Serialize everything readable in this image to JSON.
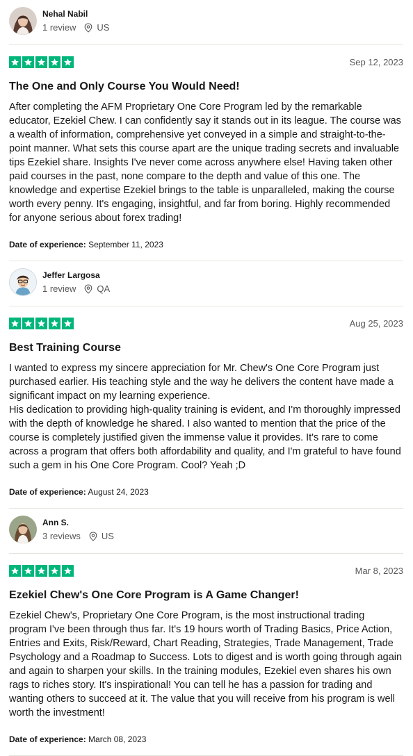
{
  "colors": {
    "star_green": "#00b67a",
    "muted": "#575757",
    "divider": "#e5e5dd"
  },
  "reviews": [
    {
      "reviewer": {
        "name": "Nehal Nabil",
        "review_count": "1 review",
        "country": "US"
      },
      "rating": 5,
      "date": "Sep 12, 2023",
      "title": "The One and Only Course You Would Need!",
      "body": [
        "After completing the AFM Proprietary One Core Program led by the remarkable educator, Ezekiel Chew. I can confidently say it stands out in its league. The course was a wealth of information, comprehensive yet conveyed in a simple and straight-to-the-point manner. What sets this course apart are the unique trading secrets and invaluable tips Ezekiel share. Insights I've never come across anywhere else! Having taken other paid courses in the past, none compare to the depth and value of this one. The knowledge and expertise Ezekiel brings to the table is unparalleled, making the course worth every penny. It's engaging, insightful, and far from boring. Highly recommended for anyone serious about forex trading!"
      ],
      "experience_label": "Date of experience:",
      "experience_date": "September 11, 2023"
    },
    {
      "reviewer": {
        "name": "Jeffer Largosa",
        "review_count": "1 review",
        "country": "QA"
      },
      "rating": 5,
      "date": "Aug 25, 2023",
      "title": "Best Training Course",
      "body": [
        "I wanted to express my sincere appreciation for Mr. Chew's One Core Program just purchased earlier. His teaching style and the way he delivers the content have made a significant impact on my learning experience.",
        "His dedication to providing high-quality training is evident, and I'm thoroughly impressed with the depth of knowledge he shared. I also wanted to mention that the price of the course is completely justified given the immense value it provides. It's rare to come across a program that offers both affordability and quality, and I'm grateful to have found such a gem in his One Core Program. Cool? Yeah ;D"
      ],
      "experience_label": "Date of experience:",
      "experience_date": "August 24, 2023"
    },
    {
      "reviewer": {
        "name": "Ann S.",
        "review_count": "3 reviews",
        "country": "US"
      },
      "rating": 5,
      "date": "Mar 8, 2023",
      "title": "Ezekiel Chew's One Core Program is A Game Changer!",
      "body": [
        "Ezekiel Chew's, Proprietary One Core Program, is the most instructional trading program I've been through thus far. It's 19 hours worth of Trading Basics, Price Action, Entries and Exits, Risk/Reward, Chart Reading, Strategies, Trade Management, Trade Psychology and a Roadmap to Success. Lots to digest and is worth going through again and again to sharpen your skills. In the training modules, Ezekiel even shares his own rags to riches story. It's inspirational! You can tell he has a passion for trading and wanting others to succeed at it. The value that you will receive from his program is well worth the investment!"
      ],
      "experience_label": "Date of experience:",
      "experience_date": "March 08, 2023"
    }
  ]
}
